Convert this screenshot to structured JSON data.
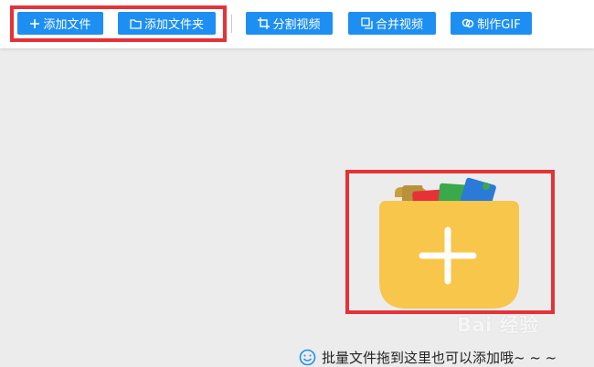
{
  "toolbar": {
    "add_file_label": "添加文件",
    "add_folder_label": "添加文件夹",
    "split_video_label": "分割视频",
    "merge_video_label": "合并视频",
    "make_gif_label": "制作GIF"
  },
  "dropzone": {
    "hint_text": "批量文件拖到这里也可以添加哦~ ~ ~"
  },
  "watermark": {
    "text": "Bai 经验"
  },
  "colors": {
    "button_blue": "#1e8ff2",
    "highlight_red": "#e53238",
    "folder_yellow": "#f7c64a",
    "background": "#ececec"
  },
  "icons": {
    "add_file": "plus-icon",
    "add_folder": "folder-icon",
    "split_video": "crop-icon",
    "merge_video": "merge-icon",
    "make_gif": "link-icon",
    "dropzone": "folder-with-files-icon",
    "hint": "smile-icon"
  }
}
